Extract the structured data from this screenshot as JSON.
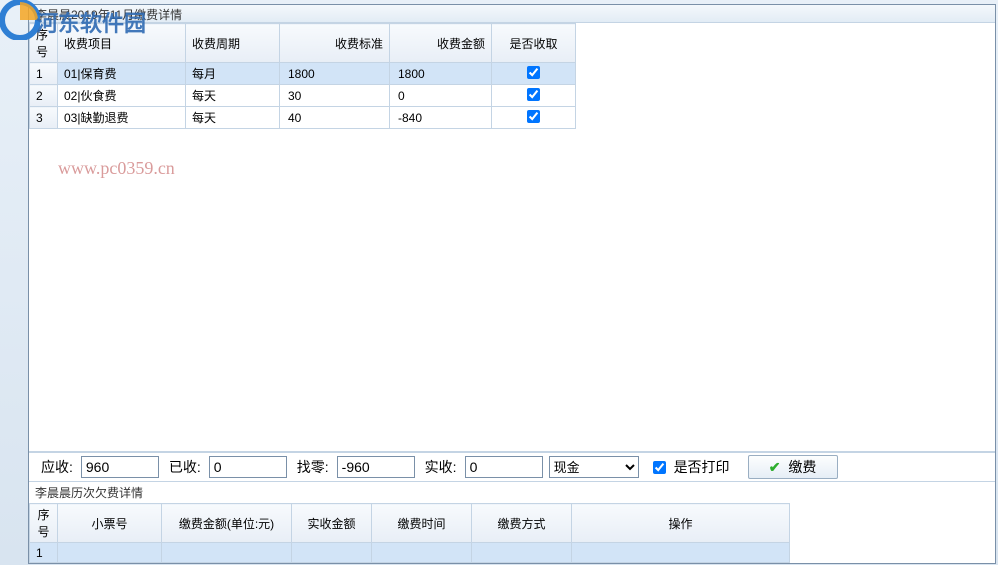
{
  "watermark": {
    "site": "河东软件园",
    "url": "www.pc0359.cn"
  },
  "window": {
    "title": "李晨晨2019年11月缴费详情"
  },
  "feeTable": {
    "headers": {
      "seq": "序号",
      "item": "收费项目",
      "cycle": "收费周期",
      "std": "收费标准",
      "amount": "收费金额",
      "collect": "是否收取"
    },
    "rows": [
      {
        "seq": "1",
        "item": "01|保育费",
        "cycle": "每月",
        "std": "1800",
        "amount": "1800",
        "collect": true,
        "selected": true
      },
      {
        "seq": "2",
        "item": "02|伙食费",
        "cycle": "每天",
        "std": "30",
        "amount": "0",
        "collect": true,
        "selected": false
      },
      {
        "seq": "3",
        "item": "03|缺勤退费",
        "cycle": "每天",
        "std": "40",
        "amount": "-840",
        "collect": true,
        "selected": false
      }
    ]
  },
  "summary": {
    "labels": {
      "should": "应收:",
      "already": "已收:",
      "change": "找零:",
      "actual": "实收:",
      "print": "是否打印",
      "pay": "缴费"
    },
    "values": {
      "should": "960",
      "already": "0",
      "change": "-960",
      "actual": "0",
      "method": "现金",
      "print": true
    }
  },
  "history": {
    "title": "李晨晨历次欠费详情",
    "headers": {
      "seq": "序号",
      "ticket": "小票号",
      "amount": "缴费金额(单位:元)",
      "actual": "实收金额",
      "time": "缴费时间",
      "way": "缴费方式",
      "op": "操作"
    },
    "rows": [
      {
        "seq": "1",
        "ticket": "",
        "amount": "",
        "actual": "",
        "time": "",
        "way": "",
        "op": "",
        "selected": true
      }
    ]
  }
}
